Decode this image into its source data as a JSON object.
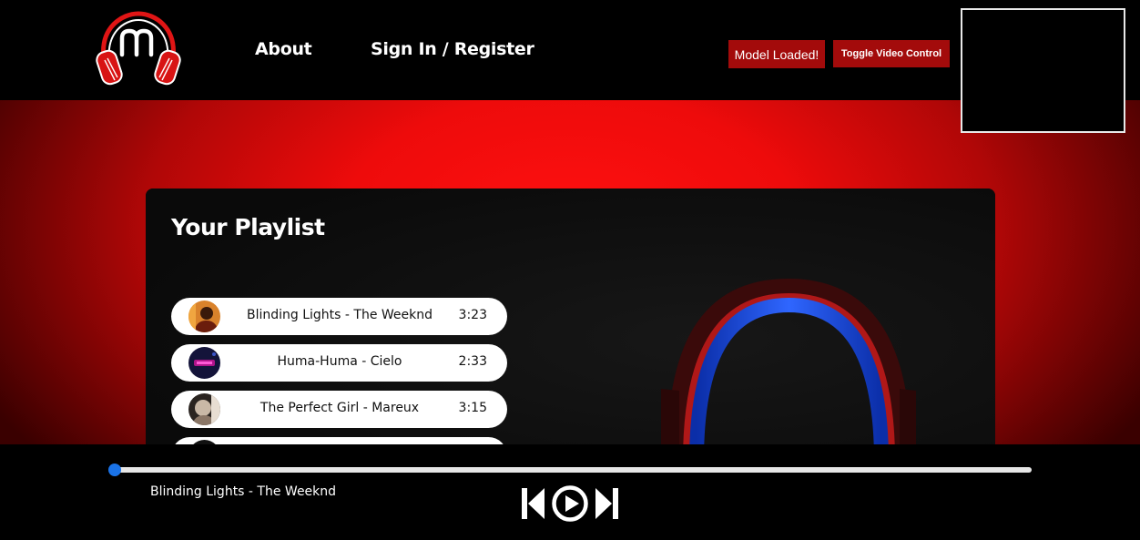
{
  "header": {
    "logo_icon": "headphones-m-logo-icon",
    "nav": {
      "about": "About",
      "signin": "Sign In / Register"
    },
    "model_status": "Model Loaded!",
    "toggle_video": "Toggle Video Control"
  },
  "colors": {
    "accent_red": "#a30b0b",
    "glow_red": "#ff1010",
    "progress_blue": "#1a73e8"
  },
  "playlist": {
    "title": "Your Playlist",
    "tracks": [
      {
        "title": "Blinding Lights - The Weeknd",
        "duration": "3:23",
        "thumb_icon": "album-art-icon"
      },
      {
        "title": "Huma-Huma - Cielo",
        "duration": "2:33",
        "thumb_icon": "album-art-icon"
      },
      {
        "title": "The Perfect Girl - Mareux",
        "duration": "3:15",
        "thumb_icon": "album-art-icon"
      }
    ]
  },
  "player": {
    "now_playing": "Blinding Lights - The Weeknd",
    "progress": 0,
    "controls": {
      "prev_icon": "skip-previous-icon",
      "play_icon": "play-circle-icon",
      "next_icon": "skip-next-icon"
    }
  }
}
